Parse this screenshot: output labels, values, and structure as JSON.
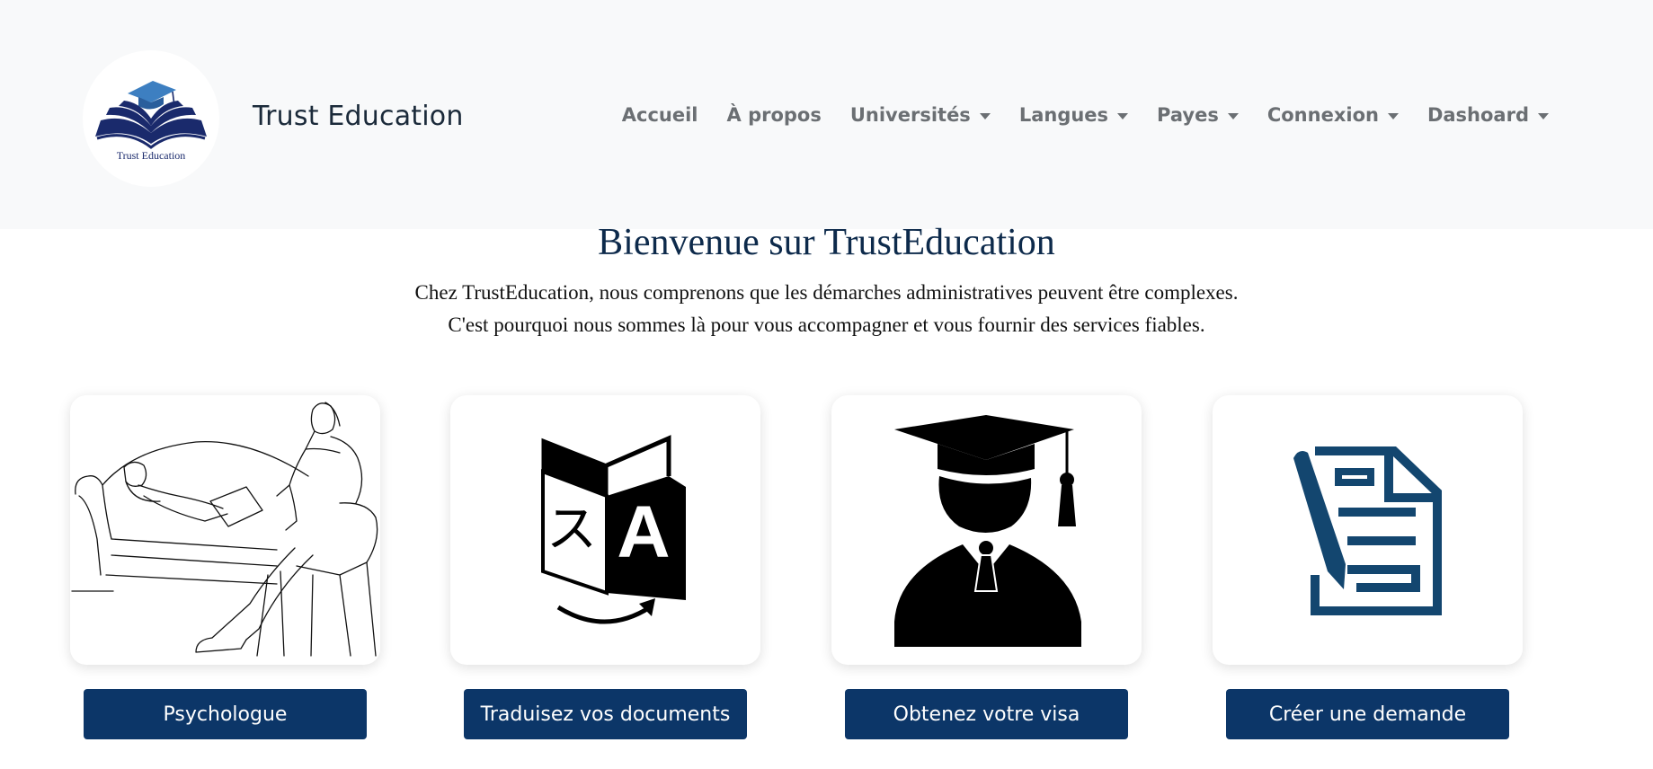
{
  "header": {
    "logo_text": "Trust Education",
    "brand": "Trust Education",
    "nav": [
      {
        "label": "Accueil",
        "dropdown": false
      },
      {
        "label": "À propos",
        "dropdown": false
      },
      {
        "label": "Universités",
        "dropdown": true
      },
      {
        "label": "Langues",
        "dropdown": true
      },
      {
        "label": "Payes",
        "dropdown": true
      },
      {
        "label": "Connexion",
        "dropdown": true
      },
      {
        "label": "Dashoard",
        "dropdown": true
      }
    ]
  },
  "hero": {
    "title": "Bienvenue sur TrustEducation",
    "line1": "Chez TrustEducation, nous comprenons que les démarches administratives peuvent être complexes.",
    "line2": "C'est pourquoi nous sommes là pour vous accompagner et vous fournir des services fiables."
  },
  "services": [
    {
      "icon": "psychologist-session-illustration",
      "button": "Psychologue"
    },
    {
      "icon": "translate-icon",
      "button": "Traduisez vos documents"
    },
    {
      "icon": "graduate-icon",
      "button": "Obtenez votre visa"
    },
    {
      "icon": "document-form-icon",
      "button": "Créer une demande"
    }
  ],
  "colors": {
    "navbar_bg": "#f8f9fa",
    "button_bg": "#0c3668",
    "title_color": "#0d2a4b",
    "document_icon": "#13466f",
    "logo_blue": "#1a2a6c",
    "cap_blue": "#3d7fc1"
  }
}
